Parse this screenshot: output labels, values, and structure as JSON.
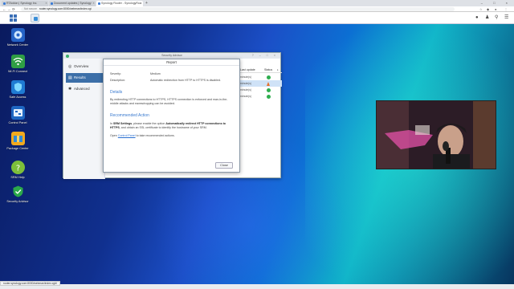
{
  "browser": {
    "tabs": [
      {
        "title": "RTAddon | Synology Inc.",
        "active": false
      },
      {
        "title": "Document updates | Synology",
        "active": false
      },
      {
        "title": "Synology Router - SynologyRou",
        "active": true
      }
    ],
    "new_tab": "+",
    "window_controls": [
      "–",
      "□",
      "×"
    ],
    "nav": {
      "back": "←",
      "forward": "→",
      "reload": "⟳",
      "home": "⌂"
    },
    "address": {
      "security_label": "Not secure",
      "url": "router.synology.com:8000/webman/index.cgi"
    }
  },
  "dsm_bar": {
    "icons": [
      "chat-icon",
      "user-icon",
      "search-icon",
      "options-icon",
      "widgets-icon"
    ]
  },
  "desktop_icons": [
    {
      "label": "Network Center",
      "icon": "network-center-icon"
    },
    {
      "label": "Wi-Fi Connect",
      "icon": "wifi-icon"
    },
    {
      "label": "Safe Access",
      "icon": "safe-access-icon"
    },
    {
      "label": "Control Panel",
      "icon": "control-panel-icon"
    },
    {
      "label": "Package Center",
      "icon": "package-center-icon"
    },
    {
      "label": "SRM Help",
      "icon": "help-icon"
    },
    {
      "label": "Security Advisor",
      "icon": "security-advisor-icon"
    }
  ],
  "security_advisor": {
    "title": "Security Advisor",
    "controls": [
      "?",
      "–",
      "□",
      "×"
    ],
    "nav": [
      {
        "label": "Overview",
        "active": false
      },
      {
        "label": "Results",
        "active": true
      },
      {
        "label": "Advanced",
        "active": false
      }
    ],
    "list": {
      "headers": [
        "Last update",
        "Status"
      ],
      "rows": [
        {
          "time": "minute(s)",
          "status": "ok"
        },
        {
          "time": "minute(s)",
          "status": "warning"
        },
        {
          "time": "minute(s)",
          "status": "ok"
        },
        {
          "time": "minute(s)",
          "status": "ok"
        }
      ]
    }
  },
  "report": {
    "title": "Report",
    "severity_label": "Severity:",
    "severity_value": "Medium",
    "description_label": "Description:",
    "description_value": "Automatic redirection from HTTP to HTTPS is disabled.",
    "details_heading": "Details",
    "details_text": "By redirecting HTTP connections to HTTPS, HTTPS connection is enforced and man-in-the-middle attacks and eavesdropping can be avoided.",
    "action_heading": "Recommended Action",
    "action_pre": "In ",
    "action_b1": "SRM Settings",
    "action_mid": ", please enable the option ",
    "action_b2": "Automatically redirect HTTP connections to HTTPS",
    "action_post": ", and obtain an SSL certificate to identify the hostname of your SRM.",
    "open_pre": "Open ",
    "open_link": "Control Panel",
    "open_post": " to take recommended actions.",
    "close_button": "Close"
  },
  "status_bar": {
    "text": "router.synology.com:8000/webman/index.cgi#"
  }
}
